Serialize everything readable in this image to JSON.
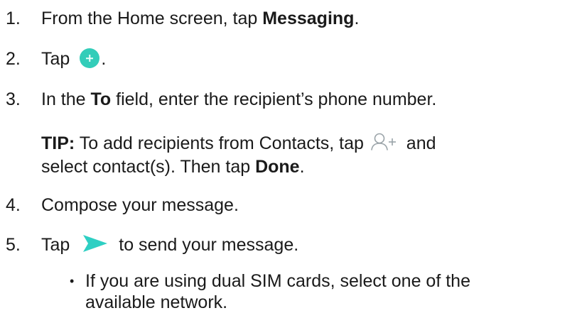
{
  "steps": [
    {
      "number": "1.",
      "pre": "From the Home screen, tap ",
      "bold": "Messaging",
      "post": "."
    },
    {
      "number": "2.",
      "pre": "Tap",
      "post": ".",
      "icon": "new-message-plus-icon"
    },
    {
      "number": "3.",
      "pre": "In the ",
      "bold": "To",
      "post": " field, enter the recipient’s phone number."
    },
    {
      "number": "4.",
      "text": "Compose your message."
    },
    {
      "number": "5.",
      "pre": "Tap",
      "post": " to send your message.",
      "icon": "send-arrow-icon"
    }
  ],
  "tip": {
    "label": "TIP:",
    "pre": " To add recipients from Contacts, tap ",
    "post": " and",
    "line2_pre": "select contact(s). Then tap ",
    "line2_bold": "Done",
    "line2_post": ".",
    "icon": "add-contact-icon"
  },
  "bullet": {
    "symbol": "•",
    "line1": "If you are using dual SIM cards, select one of the",
    "line2": "available network."
  },
  "colors": {
    "plus_icon": "#33cdb9",
    "send_icon": "#2ecfc3",
    "contact_icon": "#9aa3a8",
    "text": "#1a1a1a"
  }
}
